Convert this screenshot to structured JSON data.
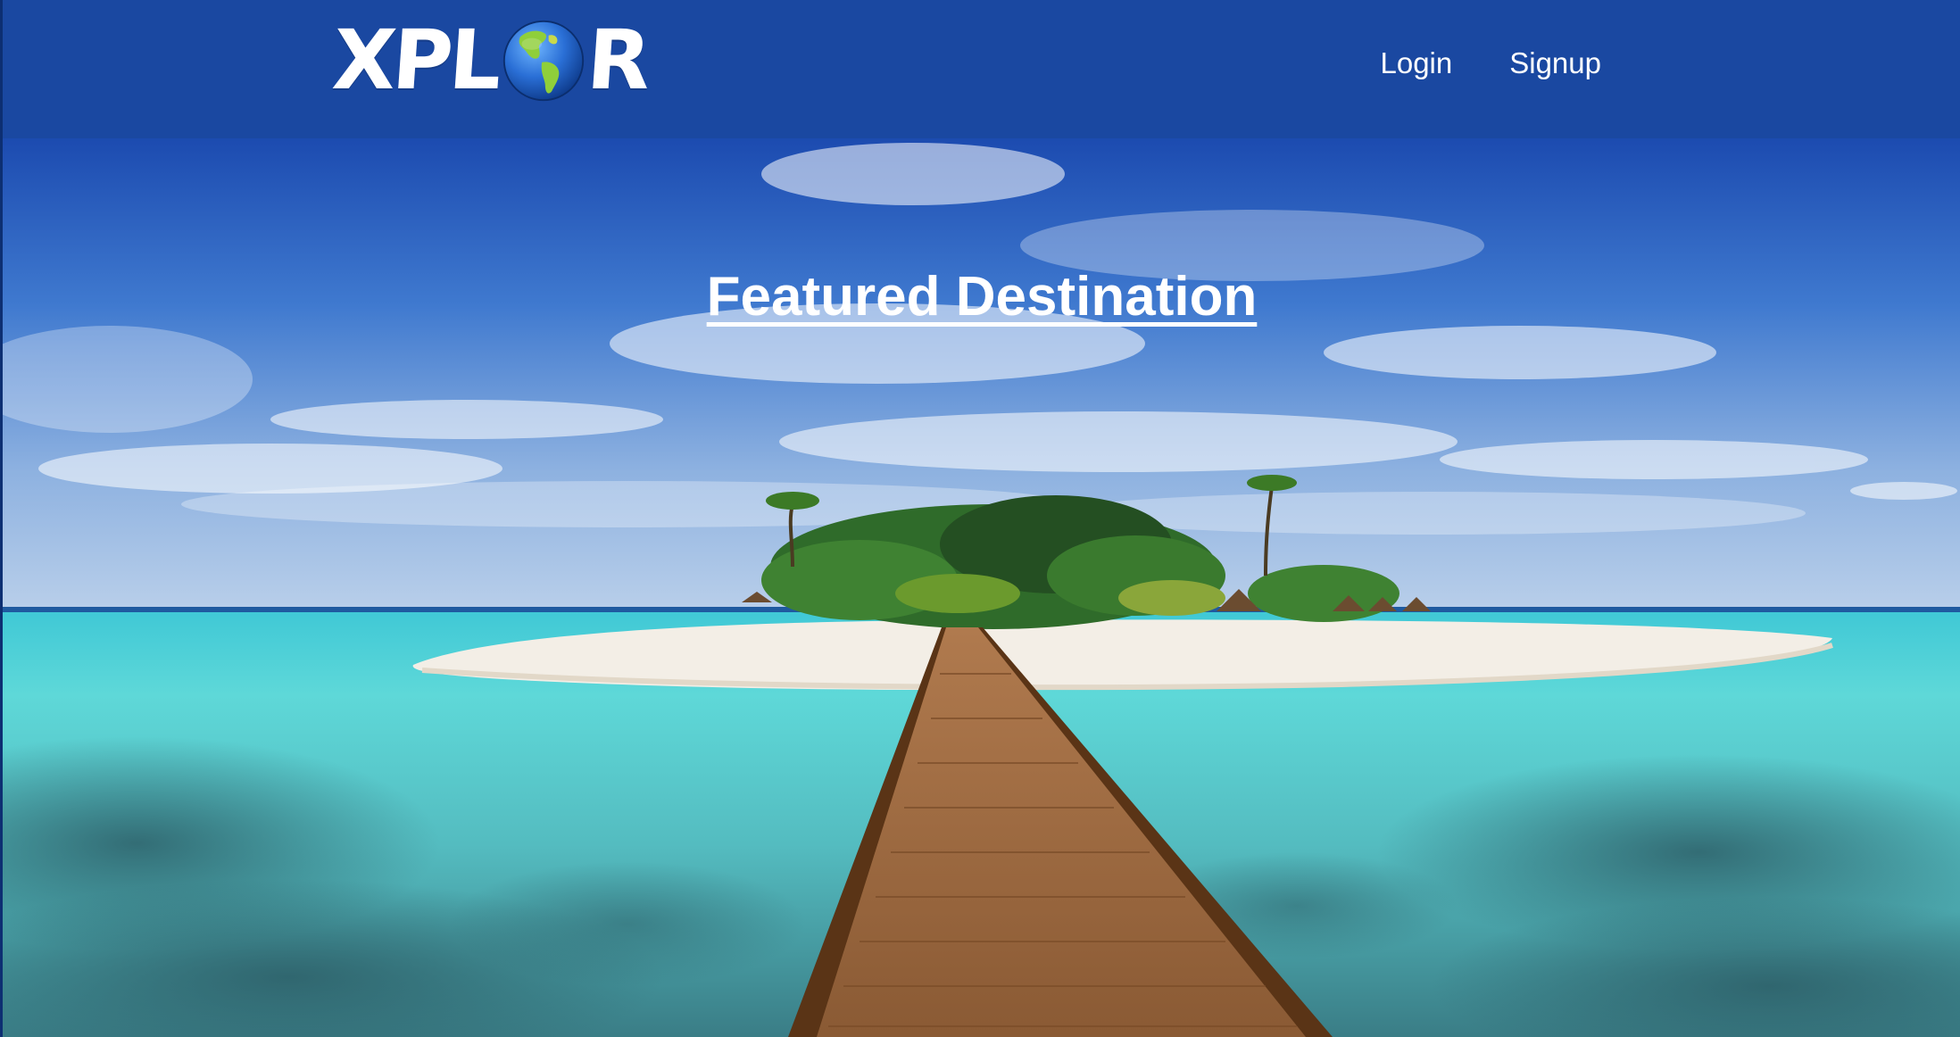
{
  "brand": {
    "logo_prefix": "XPL",
    "logo_suffix": "R",
    "logo_alt": "XPLOR",
    "globe_icon": "globe-americas-icon"
  },
  "nav": {
    "login": "Login",
    "signup": "Signup"
  },
  "hero": {
    "title": "Featured Destination",
    "image": "island-boardwalk-photo"
  },
  "colors": {
    "navbar": "#1a48a1",
    "text": "#ffffff"
  }
}
